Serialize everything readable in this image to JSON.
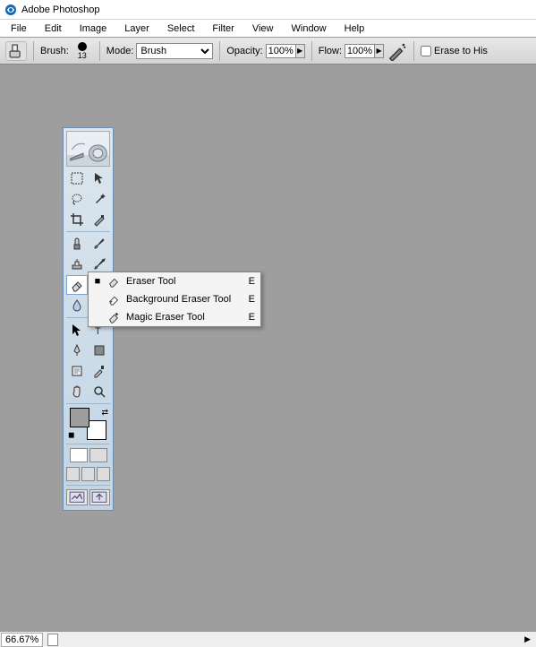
{
  "title": "Adobe Photoshop",
  "menu": [
    "File",
    "Edit",
    "Image",
    "Layer",
    "Select",
    "Filter",
    "View",
    "Window",
    "Help"
  ],
  "optbar": {
    "brush_label": "Brush:",
    "brush_size": "13",
    "mode_label": "Mode:",
    "mode_value": "Brush",
    "opacity_label": "Opacity:",
    "opacity_value": "100%",
    "flow_label": "Flow:",
    "flow_value": "100%",
    "erase_label": "Erase to His"
  },
  "flyout": [
    {
      "mark": "■",
      "label": "Eraser Tool",
      "key": "E"
    },
    {
      "mark": "",
      "label": "Background Eraser Tool",
      "key": "E"
    },
    {
      "mark": "",
      "label": "Magic Eraser Tool",
      "key": "E"
    }
  ],
  "status": {
    "zoom": "66.67%"
  }
}
